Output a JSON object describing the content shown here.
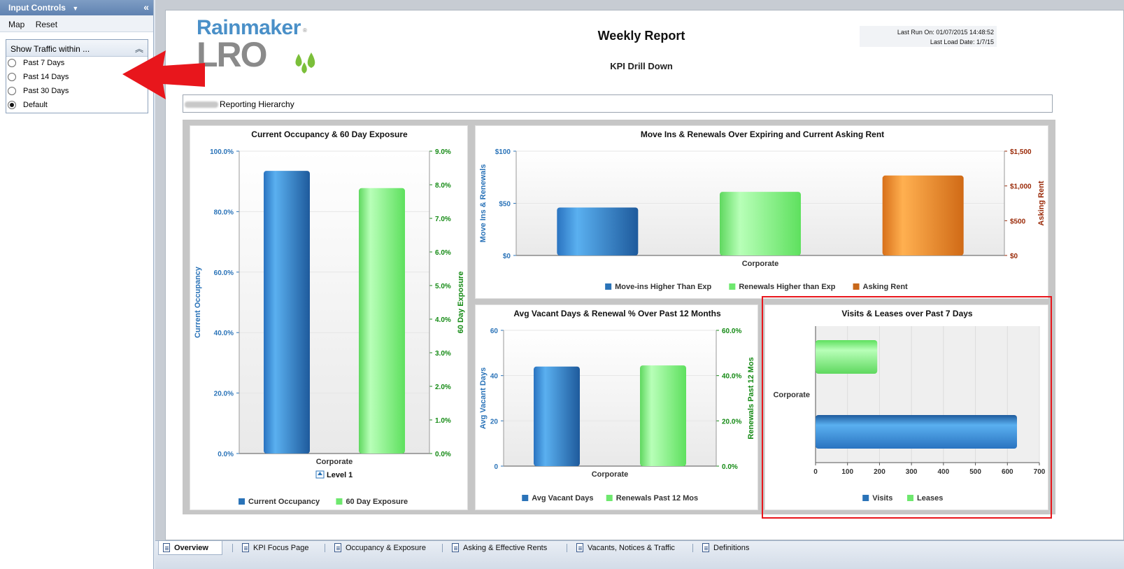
{
  "left_panel": {
    "title": "Input Controls",
    "toolbar": {
      "map": "Map",
      "reset": "Reset"
    },
    "traffic": {
      "title": "Show Traffic within ...",
      "options": [
        "Past 7 Days",
        "Past 14 Days",
        "Past 30 Days",
        "Default"
      ],
      "selected": "Default"
    }
  },
  "report": {
    "logo": {
      "top": "Rainmaker",
      "bottom": "LRO",
      "reg": "®"
    },
    "title": "Weekly Report",
    "subtitle": "KPI Drill Down",
    "last_run": "Last Run On: 01/07/2015 14:48:52",
    "last_load": "Last Load Date: 1/7/15",
    "hierarchy_label": "Reporting Hierarchy"
  },
  "colors": {
    "blue": "#2a73b8",
    "green": "#7df07d",
    "orange": "#e8801e",
    "annotation_red": "#e8161c"
  },
  "chart_data": [
    {
      "type": "bar",
      "title": "Current Occupancy & 60 Day Exposure",
      "categories": [
        "Corporate"
      ],
      "series": [
        {
          "name": "Current  Occupancy",
          "values": [
            93.5
          ],
          "axis": "left"
        },
        {
          "name": "60 Day Exposure",
          "values": [
            7.9
          ],
          "axis": "right"
        }
      ],
      "ylabel": "Current  Occupancy",
      "ylabel_right": "60 Day Exposure",
      "ylim": [
        0,
        100
      ],
      "ylim_right": [
        0,
        9
      ],
      "yticks": [
        "0.0%",
        "20.0%",
        "40.0%",
        "60.0%",
        "80.0%",
        "100.0%"
      ],
      "yticks_right": [
        "0.0%",
        "1.0%",
        "2.0%",
        "3.0%",
        "4.0%",
        "5.0%",
        "6.0%",
        "7.0%",
        "8.0%",
        "9.0%"
      ],
      "drill_label": "Level 1",
      "legend": "bottom"
    },
    {
      "type": "bar",
      "title": "Move Ins & Renewals Over Expiring and Current Asking Rent",
      "categories": [
        "Corporate"
      ],
      "series": [
        {
          "name": "Move-ins Higher Than Exp",
          "values": [
            46
          ],
          "axis": "left"
        },
        {
          "name": "Renewals Higher than Exp",
          "values": [
            61
          ],
          "axis": "left"
        },
        {
          "name": "Asking Rent",
          "values": [
            1150
          ],
          "axis": "right"
        }
      ],
      "ylabel": "Move Ins & Renewals",
      "ylabel_right": "Asking Rent",
      "ylim": [
        0,
        100
      ],
      "ylim_right": [
        0,
        1500
      ],
      "yticks": [
        "$0",
        "$50",
        "$100"
      ],
      "yticks_right": [
        "$0",
        "$500",
        "$1,000",
        "$1,500"
      ],
      "legend": "bottom"
    },
    {
      "type": "bar",
      "title": "Avg Vacant Days & Renewal % Over Past 12 Months",
      "categories": [
        "Corporate"
      ],
      "series": [
        {
          "name": "Avg Vacant Days",
          "values": [
            44
          ],
          "axis": "left"
        },
        {
          "name": "Renewals Past 12 Mos",
          "values": [
            44.5
          ],
          "axis": "right"
        }
      ],
      "ylabel": "Avg Vacant Days",
      "ylabel_right": "Renewals Past 12 Mos",
      "ylim": [
        0,
        60
      ],
      "ylim_right": [
        0,
        60
      ],
      "yticks": [
        "0",
        "20",
        "40",
        "60"
      ],
      "yticks_right": [
        "0.0%",
        "20.0%",
        "40.0%",
        "60.0%"
      ],
      "legend": "bottom"
    },
    {
      "type": "bar",
      "orientation": "horizontal",
      "title": "Visits & Leases over Past 7 Days",
      "categories": [
        "Corporate"
      ],
      "series": [
        {
          "name": "Visits",
          "values": [
            630
          ]
        },
        {
          "name": "Leases",
          "values": [
            193
          ]
        }
      ],
      "xlim": [
        0,
        700
      ],
      "xticks": [
        "0",
        "100",
        "200",
        "300",
        "400",
        "500",
        "600",
        "700"
      ],
      "legend": "bottom"
    }
  ],
  "tabs": [
    {
      "label": "Overview",
      "active": true
    },
    {
      "label": "KPI Focus Page",
      "active": false
    },
    {
      "label": "Occupancy & Exposure",
      "active": false
    },
    {
      "label": "Asking & Effective Rents",
      "active": false
    },
    {
      "label": "Vacants, Notices & Traffic",
      "active": false
    },
    {
      "label": "Definitions",
      "active": false
    }
  ]
}
